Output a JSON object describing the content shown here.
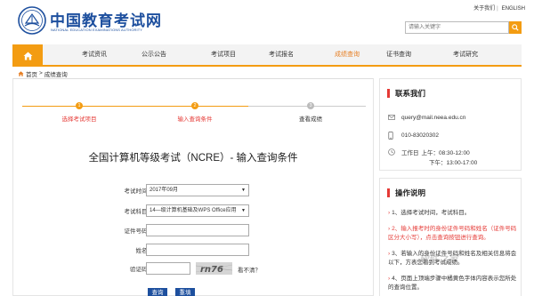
{
  "header": {
    "logo_cn": "中国教育考试网",
    "logo_en": "NATIONAL EDUCATION EXAMINATIONS AUTHORITY",
    "top_links": [
      "关于我们",
      "ENGLISH"
    ],
    "search_placeholder": "请输入关键字"
  },
  "nav": {
    "items": [
      {
        "label": "考试资讯"
      },
      {
        "label": "公示公告"
      },
      {
        "label": "考试项目"
      },
      {
        "label": "考试报名"
      },
      {
        "label": "成绩查询"
      },
      {
        "label": "证书查询"
      },
      {
        "label": "考试研究"
      }
    ],
    "active": "成绩查询"
  },
  "breadcrumb": {
    "home": "首页",
    "sep": ">",
    "current": "成绩查询"
  },
  "steps": [
    {
      "num": "1",
      "label": "选择考试项目"
    },
    {
      "num": "2",
      "label": "输入查询条件"
    },
    {
      "num": "3",
      "label": "查看成绩"
    }
  ],
  "page_title": "全国计算机等级考试（NCRE）- 输入查询条件",
  "form": {
    "exam_time_label": "考试时间：",
    "exam_time_value": "2017年09月",
    "subject_label": "考试科目：",
    "subject_value": "14—级计算机基础及WPS Office应用",
    "id_label": "证件号码：",
    "name_label": "姓名：",
    "captcha_label": "验证码：",
    "captcha_text": "rn76",
    "captcha_link": "看不清？",
    "search_button": "查询",
    "reset_button": "重填"
  },
  "contact": {
    "title": "联系我们",
    "email": "query@mail.neea.edu.cn",
    "phone": "010-83020302",
    "hours_label": "工作日",
    "hours_am": "上午：08:30-12:00",
    "hours_pm": "下午：13:00-17:00"
  },
  "instructions": {
    "title": "操作说明",
    "items": [
      "1、选择考试时间，考试科目。",
      "2、输入报考时的身份证件号码和姓名（证件号码区分大小写），点击查询按钮进行查询。",
      "3、若输入的身份证件号码和姓名及相关信息将会以下，方表您看到考试成绩。",
      "4、页面上顶端步骤中橘黄色字体内容表示您所处的查询位置。"
    ]
  },
  "watermark": "软件之家",
  "colors": {
    "orange": "#f39c12",
    "blue": "#1d4f9e",
    "red": "#e53935"
  }
}
